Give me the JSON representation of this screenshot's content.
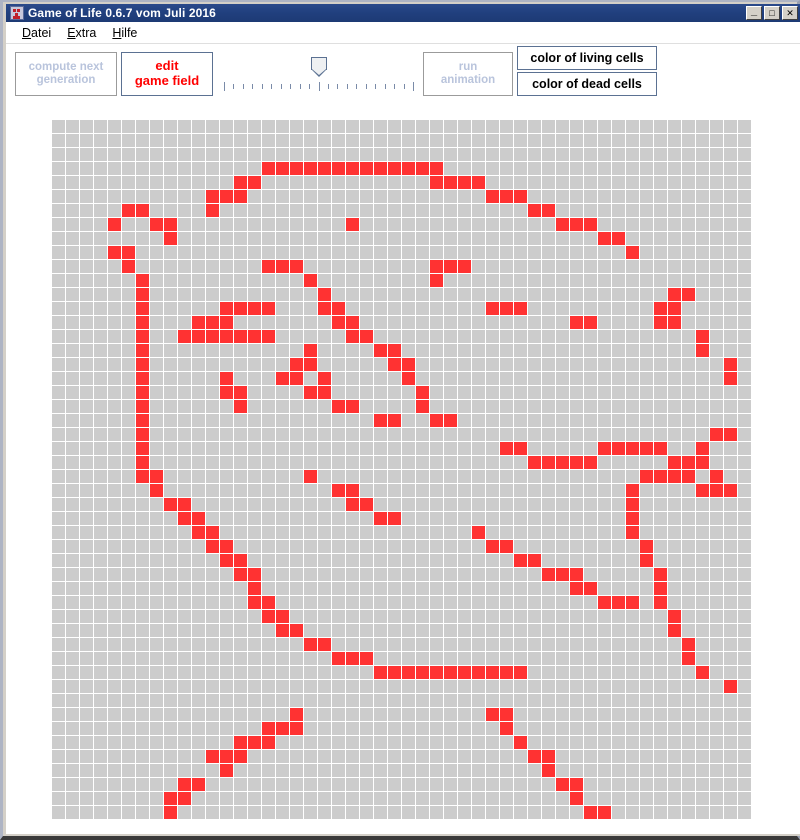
{
  "window": {
    "title": "Game of Life 0.6.7 vom Juli 2016",
    "icon": "app-icon",
    "buttons": {
      "minimize": "_",
      "maximize": "□",
      "close": "✕"
    }
  },
  "menu": {
    "items": [
      {
        "label": "Datei",
        "mnemonic": "D"
      },
      {
        "label": "Extra",
        "mnemonic": "E"
      },
      {
        "label": "Hilfe",
        "mnemonic": "H"
      }
    ]
  },
  "toolbar": {
    "compute_next_generation": "compute next\ngeneration",
    "edit_game_field": "edit\ngame field",
    "run_animation": "run\nanimation",
    "color_of_living_cells": "color of living cells",
    "color_of_dead_cells": "color of dead cells"
  },
  "speed_slider": {
    "name": "speed-slider",
    "tick_count": 21,
    "major_ticks": [
      0,
      10,
      20
    ],
    "value": 10,
    "min": 0,
    "max": 20
  },
  "colors": {
    "living_cell": "#ff3232",
    "dead_cell": "#cccccc",
    "grid_line": "#ffffff",
    "accent": "#ff0000",
    "titlebar": "#21407f",
    "button_border": "#5b7192",
    "disabled_text": "#b9c4dc"
  },
  "game_field": {
    "columns": 50,
    "rows": 50,
    "live_cells": [
      [
        3,
        15
      ],
      [
        3,
        16
      ],
      [
        3,
        17
      ],
      [
        3,
        18
      ],
      [
        3,
        19
      ],
      [
        3,
        20
      ],
      [
        3,
        21
      ],
      [
        3,
        22
      ],
      [
        3,
        23
      ],
      [
        3,
        24
      ],
      [
        3,
        25
      ],
      [
        3,
        26
      ],
      [
        3,
        27
      ],
      [
        4,
        13
      ],
      [
        4,
        14
      ],
      [
        4,
        27
      ],
      [
        4,
        28
      ],
      [
        4,
        29
      ],
      [
        4,
        30
      ],
      [
        5,
        11
      ],
      [
        5,
        12
      ],
      [
        5,
        13
      ],
      [
        5,
        31
      ],
      [
        5,
        32
      ],
      [
        5,
        33
      ],
      [
        6,
        5
      ],
      [
        6,
        6
      ],
      [
        6,
        11
      ],
      [
        6,
        34
      ],
      [
        6,
        35
      ],
      [
        7,
        4
      ],
      [
        7,
        7
      ],
      [
        7,
        8
      ],
      [
        7,
        21
      ],
      [
        7,
        36
      ],
      [
        7,
        37
      ],
      [
        7,
        38
      ],
      [
        8,
        8
      ],
      [
        8,
        39
      ],
      [
        8,
        40
      ],
      [
        9,
        4
      ],
      [
        9,
        5
      ],
      [
        9,
        41
      ],
      [
        10,
        5
      ],
      [
        10,
        15
      ],
      [
        10,
        16
      ],
      [
        10,
        17
      ],
      [
        10,
        27
      ],
      [
        10,
        28
      ],
      [
        10,
        29
      ],
      [
        11,
        6
      ],
      [
        11,
        18
      ],
      [
        11,
        27
      ],
      [
        12,
        6
      ],
      [
        12,
        19
      ],
      [
        12,
        44
      ],
      [
        12,
        45
      ],
      [
        13,
        6
      ],
      [
        13,
        12
      ],
      [
        13,
        13
      ],
      [
        13,
        14
      ],
      [
        13,
        15
      ],
      [
        13,
        19
      ],
      [
        13,
        20
      ],
      [
        13,
        31
      ],
      [
        13,
        32
      ],
      [
        13,
        33
      ],
      [
        13,
        43
      ],
      [
        13,
        44
      ],
      [
        14,
        6
      ],
      [
        14,
        10
      ],
      [
        14,
        11
      ],
      [
        14,
        12
      ],
      [
        14,
        20
      ],
      [
        14,
        21
      ],
      [
        14,
        43
      ],
      [
        14,
        44
      ],
      [
        14,
        37
      ],
      [
        14,
        38
      ],
      [
        15,
        6
      ],
      [
        15,
        9
      ],
      [
        15,
        10
      ],
      [
        15,
        11
      ],
      [
        15,
        12
      ],
      [
        15,
        13
      ],
      [
        15,
        14
      ],
      [
        15,
        15
      ],
      [
        15,
        21
      ],
      [
        15,
        22
      ],
      [
        15,
        46
      ],
      [
        16,
        6
      ],
      [
        16,
        18
      ],
      [
        16,
        23
      ],
      [
        16,
        24
      ],
      [
        16,
        46
      ],
      [
        17,
        6
      ],
      [
        17,
        17
      ],
      [
        17,
        18
      ],
      [
        17,
        24
      ],
      [
        17,
        25
      ],
      [
        17,
        48
      ],
      [
        18,
        6
      ],
      [
        18,
        12
      ],
      [
        18,
        16
      ],
      [
        18,
        17
      ],
      [
        18,
        19
      ],
      [
        18,
        25
      ],
      [
        18,
        48
      ],
      [
        19,
        6
      ],
      [
        19,
        12
      ],
      [
        19,
        13
      ],
      [
        19,
        18
      ],
      [
        19,
        19
      ],
      [
        19,
        26
      ],
      [
        20,
        6
      ],
      [
        20,
        13
      ],
      [
        20,
        20
      ],
      [
        20,
        21
      ],
      [
        20,
        26
      ],
      [
        21,
        6
      ],
      [
        21,
        23
      ],
      [
        21,
        24
      ],
      [
        21,
        27
      ],
      [
        21,
        28
      ],
      [
        22,
        6
      ],
      [
        22,
        47
      ],
      [
        22,
        48
      ],
      [
        23,
        6
      ],
      [
        23,
        32
      ],
      [
        23,
        33
      ],
      [
        23,
        39
      ],
      [
        23,
        40
      ],
      [
        23,
        41
      ],
      [
        23,
        42
      ],
      [
        23,
        43
      ],
      [
        23,
        46
      ],
      [
        24,
        6
      ],
      [
        24,
        34
      ],
      [
        24,
        35
      ],
      [
        24,
        36
      ],
      [
        24,
        37
      ],
      [
        24,
        38
      ],
      [
        24,
        44
      ],
      [
        24,
        45
      ],
      [
        24,
        46
      ],
      [
        25,
        6
      ],
      [
        25,
        7
      ],
      [
        25,
        18
      ],
      [
        25,
        42
      ],
      [
        25,
        43
      ],
      [
        25,
        44
      ],
      [
        25,
        45
      ],
      [
        25,
        47
      ],
      [
        26,
        7
      ],
      [
        26,
        20
      ],
      [
        26,
        21
      ],
      [
        26,
        41
      ],
      [
        26,
        46
      ],
      [
        26,
        47
      ],
      [
        26,
        48
      ],
      [
        27,
        8
      ],
      [
        27,
        9
      ],
      [
        27,
        21
      ],
      [
        27,
        22
      ],
      [
        27,
        41
      ],
      [
        28,
        9
      ],
      [
        28,
        10
      ],
      [
        28,
        23
      ],
      [
        28,
        24
      ],
      [
        28,
        41
      ],
      [
        29,
        10
      ],
      [
        29,
        11
      ],
      [
        29,
        30
      ],
      [
        29,
        41
      ],
      [
        30,
        11
      ],
      [
        30,
        12
      ],
      [
        30,
        31
      ],
      [
        30,
        32
      ],
      [
        30,
        42
      ],
      [
        31,
        12
      ],
      [
        31,
        13
      ],
      [
        31,
        33
      ],
      [
        31,
        34
      ],
      [
        31,
        42
      ],
      [
        32,
        13
      ],
      [
        32,
        14
      ],
      [
        32,
        35
      ],
      [
        32,
        36
      ],
      [
        32,
        37
      ],
      [
        32,
        43
      ],
      [
        33,
        14
      ],
      [
        33,
        37
      ],
      [
        33,
        38
      ],
      [
        33,
        43
      ],
      [
        34,
        14
      ],
      [
        34,
        15
      ],
      [
        34,
        39
      ],
      [
        34,
        40
      ],
      [
        34,
        41
      ],
      [
        34,
        43
      ],
      [
        35,
        15
      ],
      [
        35,
        16
      ],
      [
        35,
        44
      ],
      [
        36,
        16
      ],
      [
        36,
        17
      ],
      [
        36,
        44
      ],
      [
        37,
        18
      ],
      [
        37,
        19
      ],
      [
        37,
        45
      ],
      [
        38,
        20
      ],
      [
        38,
        21
      ],
      [
        38,
        22
      ],
      [
        38,
        45
      ],
      [
        39,
        23
      ],
      [
        39,
        24
      ],
      [
        39,
        25
      ],
      [
        39,
        26
      ],
      [
        39,
        27
      ],
      [
        39,
        28
      ],
      [
        39,
        29
      ],
      [
        39,
        30
      ],
      [
        39,
        31
      ],
      [
        39,
        32
      ],
      [
        39,
        33
      ],
      [
        39,
        46
      ],
      [
        40,
        48
      ],
      [
        42,
        17
      ],
      [
        42,
        31
      ],
      [
        42,
        32
      ],
      [
        43,
        15
      ],
      [
        43,
        16
      ],
      [
        43,
        17
      ],
      [
        43,
        32
      ],
      [
        44,
        13
      ],
      [
        44,
        14
      ],
      [
        44,
        15
      ],
      [
        44,
        33
      ],
      [
        45,
        11
      ],
      [
        45,
        12
      ],
      [
        45,
        13
      ],
      [
        45,
        34
      ],
      [
        45,
        35
      ],
      [
        46,
        12
      ],
      [
        46,
        35
      ],
      [
        47,
        9
      ],
      [
        47,
        10
      ],
      [
        47,
        36
      ],
      [
        47,
        37
      ],
      [
        48,
        8
      ],
      [
        48,
        9
      ],
      [
        48,
        37
      ],
      [
        49,
        8
      ],
      [
        49,
        38
      ],
      [
        49,
        39
      ]
    ]
  }
}
